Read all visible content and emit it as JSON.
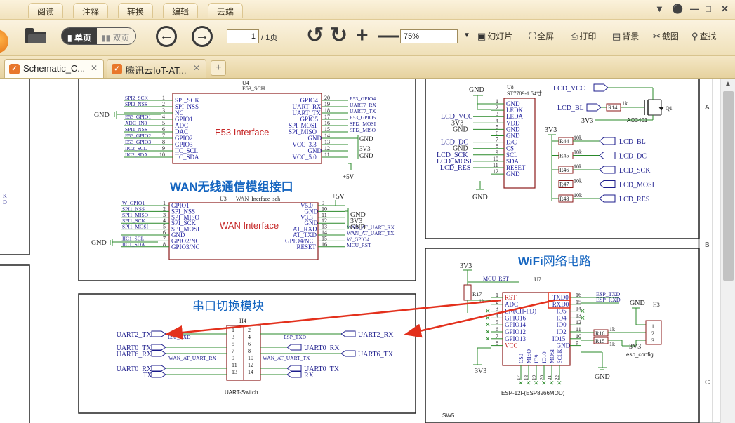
{
  "menu": {
    "items": [
      "阅读",
      "注释",
      "转换",
      "编辑",
      "云端"
    ]
  },
  "window_controls": {
    "menu": "☰",
    "skin": "▼",
    "minimize": "—",
    "maximize": "□",
    "close": "✕"
  },
  "toolbar": {
    "single_page": "单页",
    "double_page": "双页",
    "page_current": "1",
    "page_total": "/ 1页",
    "zoom": "75%",
    "slideshow": "幻灯片",
    "fullscreen": "全屏",
    "print": "打印",
    "background": "背景",
    "screenshot": "截图",
    "find": "查找"
  },
  "tabs": [
    {
      "label": "Schematic_C...",
      "active": true
    },
    {
      "label": "腾讯云IoT-AT...",
      "active": false
    }
  ],
  "schematic": {
    "u4": {
      "ref": "U4",
      "value": "E53_SCH",
      "title": "E53 Interface",
      "left_pins": [
        {
          "num": "1",
          "name": "SPI_SCK",
          "net": "SPI2_SCK"
        },
        {
          "num": "2",
          "name": "SPI_NSS",
          "net": "SPI2_NSS"
        },
        {
          "num": "3",
          "name": "NC",
          "net": ""
        },
        {
          "num": "4",
          "name": "GPIO1",
          "net": "E53_GPIO1"
        },
        {
          "num": "5",
          "name": "ADC",
          "net": "ADC_IN8"
        },
        {
          "num": "6",
          "name": "DAC",
          "net": "SPI1_NSS"
        },
        {
          "num": "7",
          "name": "GPIO2",
          "net": "E53_GPIO2"
        },
        {
          "num": "8",
          "name": "GPIO3",
          "net": "E53_GPIO3"
        },
        {
          "num": "9",
          "name": "IIC_SCL",
          "net": "IIC2_SCL"
        },
        {
          "num": "10",
          "name": "IIC_SDA",
          "net": "IIC2_SDA"
        }
      ],
      "right_pins": [
        {
          "num": "20",
          "name": "GPIO4",
          "net": "E53_GPIO4"
        },
        {
          "num": "19",
          "name": "UART_RX",
          "net": "UART7_RX"
        },
        {
          "num": "18",
          "name": "UART_TX",
          "net": "UART7_TX"
        },
        {
          "num": "17",
          "name": "GPIO5",
          "net": "E53_GPIO5"
        },
        {
          "num": "16",
          "name": "SPI_MOSI",
          "net": "SPI2_MOSI"
        },
        {
          "num": "15",
          "name": "SPI_MISO",
          "net": "SPI2_MISO"
        },
        {
          "num": "14",
          "name": "GND",
          "net": "GND"
        },
        {
          "num": "13",
          "name": "VCC_3.3",
          "net": "3V3"
        },
        {
          "num": "12",
          "name": "GND",
          "net": "GND"
        },
        {
          "num": "11",
          "name": "VCC_5.0",
          "net": "+5V"
        }
      ],
      "gnd": "GND"
    },
    "wan_title_prefix": "WAN",
    "wan_title_rest": "无线通信模组接口",
    "u3": {
      "ref": "U3",
      "value": "WAN_Inerface_sch",
      "title": "WAN Interface",
      "left_pins": [
        {
          "num": "1",
          "name": "GPIO1",
          "net": "W_GPIO1"
        },
        {
          "num": "2",
          "name": "SPI_NSS",
          "net": "SPI1_NSS"
        },
        {
          "num": "3",
          "name": "SPI_MISO",
          "net": "SPI1_MISO"
        },
        {
          "num": "4",
          "name": "SPI_SCK",
          "net": "SPI1_SCK"
        },
        {
          "num": "5",
          "name": "SPI_MOSI",
          "net": "SPI1_MOSI"
        },
        {
          "num": "6",
          "name": "GND",
          "net": ""
        },
        {
          "num": "7",
          "name": "GPIO2/NC",
          "net": "IIC1_SCL"
        },
        {
          "num": "8",
          "name": "GPIO3/NC",
          "net": "IIC1_SDA"
        }
      ],
      "right_pins": [
        {
          "num": "9",
          "name": "V5.0",
          "net": "+5V"
        },
        {
          "num": "10",
          "name": "GND",
          "net": "GND"
        },
        {
          "num": "11",
          "name": "V3.3",
          "net": "3V3"
        },
        {
          "num": "12",
          "name": "GND",
          "net": "GND"
        },
        {
          "num": "13",
          "name": "AT_RXD",
          "net": "WAN_AT_UART_RX"
        },
        {
          "num": "14",
          "name": "AT_TXD",
          "net": "WAN_AT_UART_TX"
        },
        {
          "num": "15",
          "name": "GPIO4/NC",
          "net": "W_GPIO4"
        },
        {
          "num": "16",
          "name": "RESET",
          "net": "MCU_RST"
        }
      ],
      "gnd": "GND"
    },
    "uart_title": "串口切换模块",
    "h4": {
      "ref": "H4",
      "value": "UART-Switch",
      "left_labels": [
        "UART2_TX",
        "UART0_TX",
        "UART6_RX",
        "UART0_RX",
        "TX"
      ],
      "left_nets": [
        "ESP_RXD",
        "WAN_AT_UART_RX"
      ],
      "right_labels": [
        "UART2_RX",
        "UART0_RX",
        "UART6_TX",
        "UART0_TX",
        "RX"
      ],
      "right_nets": [
        "ESP_TXD",
        "WAN_AT_UART_TX"
      ],
      "pins": [
        "1",
        "2",
        "3",
        "4",
        "5",
        "6",
        "7",
        "8",
        "9",
        "10",
        "11",
        "12",
        "13",
        "14"
      ]
    },
    "u8": {
      "ref": "U8",
      "value": "ST7789-1.54寸",
      "pins": [
        {
          "num": "1",
          "name": "GND",
          "net": "GND"
        },
        {
          "num": "2",
          "name": "LEDK",
          "net": ""
        },
        {
          "num": "3",
          "name": "LEDA",
          "net": "LCD_VCC"
        },
        {
          "num": "4",
          "name": "VDD",
          "net": "3V3"
        },
        {
          "num": "5",
          "name": "GND",
          "net": "GND"
        },
        {
          "num": "6",
          "name": "GND",
          "net": ""
        },
        {
          "num": "7",
          "name": "D/C",
          "net": "LCD_DC"
        },
        {
          "num": "8",
          "name": "CS",
          "net": "GND"
        },
        {
          "num": "9",
          "name": "SCL",
          "net": "LCD_SCK"
        },
        {
          "num": "10",
          "name": "SDA",
          "net": "LCD_MOSI"
        },
        {
          "num": "11",
          "name": "RESET",
          "net": "LCD_RES"
        },
        {
          "num": "12",
          "name": "GND",
          "net": "GND"
        }
      ],
      "top_gnd": "GND",
      "bottom_gnd": "GND"
    },
    "lcd_power": {
      "vcc_label": "LCD_VCC",
      "bl_label": "LCD_BL",
      "r14": "R14",
      "r14_val": "1k",
      "q_ref": "Q1",
      "q_part": "AO3401",
      "supply": "3V3"
    },
    "pullups": {
      "supply": "3V3",
      "rows": [
        {
          "ref": "R44",
          "val": "10k",
          "net": "LCD_BL"
        },
        {
          "ref": "R45",
          "val": "10k",
          "net": "LCD_DC"
        },
        {
          "ref": "R46",
          "val": "10k",
          "net": "LCD_SCK"
        },
        {
          "ref": "R47",
          "val": "10k",
          "net": "LCD_MOSI"
        },
        {
          "ref": "R48",
          "val": "10k",
          "net": "LCD_RES"
        }
      ]
    },
    "wifi_title_prefix": "WiFi",
    "wifi_title_rest": "网络电路",
    "u7": {
      "ref": "U7",
      "value": "ESP-12F(ESP8266MOD)",
      "left_pins": [
        {
          "num": "1",
          "name": "RST"
        },
        {
          "num": "2",
          "name": "ADC"
        },
        {
          "num": "3",
          "name": "EN(CH-PD)"
        },
        {
          "num": "4",
          "name": "GPIO16"
        },
        {
          "num": "5",
          "name": "GPIO14"
        },
        {
          "num": "6",
          "name": "GPIO12"
        },
        {
          "num": "7",
          "name": "GPIO13"
        },
        {
          "num": "8",
          "name": "VCC"
        }
      ],
      "right_pins": [
        {
          "num": "16",
          "name": "TXD0"
        },
        {
          "num": "15",
          "name": "RXD0"
        },
        {
          "num": "14",
          "name": "IO5"
        },
        {
          "num": "13",
          "name": "IO4"
        },
        {
          "num": "12",
          "name": "IO0"
        },
        {
          "num": "11",
          "name": "IO2"
        },
        {
          "num": "10",
          "name": "IO15"
        },
        {
          "num": "9",
          "name": "GND"
        }
      ],
      "bottom_pins": [
        "CS0",
        "MISO",
        "IO9",
        "IO10",
        "MOSI",
        "SCLK"
      ],
      "bottom_nums": [
        "17",
        "18",
        "19",
        "20",
        "21",
        "22"
      ],
      "nets": {
        "mcu_rst": "MCU_RST",
        "esp_txd": "ESP_TXD",
        "esp_rxd": "ESP_RXD"
      },
      "r17": "R17",
      "r17_val": "1k",
      "r16": "R16",
      "r16_val": "1k",
      "r15": "R15",
      "r15_val": "1k",
      "supply": "3V3",
      "gnd": "GND",
      "h3": "H3",
      "h3_pins": [
        "1",
        "2",
        "3"
      ],
      "h3_value": "esp_config",
      "sw": "SW5"
    },
    "frame_letters": [
      "A",
      "B",
      "C"
    ],
    "edge_left": "K\nD"
  },
  "colors": {
    "wire": "#2a8a2a",
    "body": "#8b1a1a",
    "pin_text": "#1f1f9e",
    "net_text": "#1d1d8c",
    "title_blue": "#1565c0",
    "red_title": "#c62828",
    "annotation_arrow": "#e3301c"
  }
}
